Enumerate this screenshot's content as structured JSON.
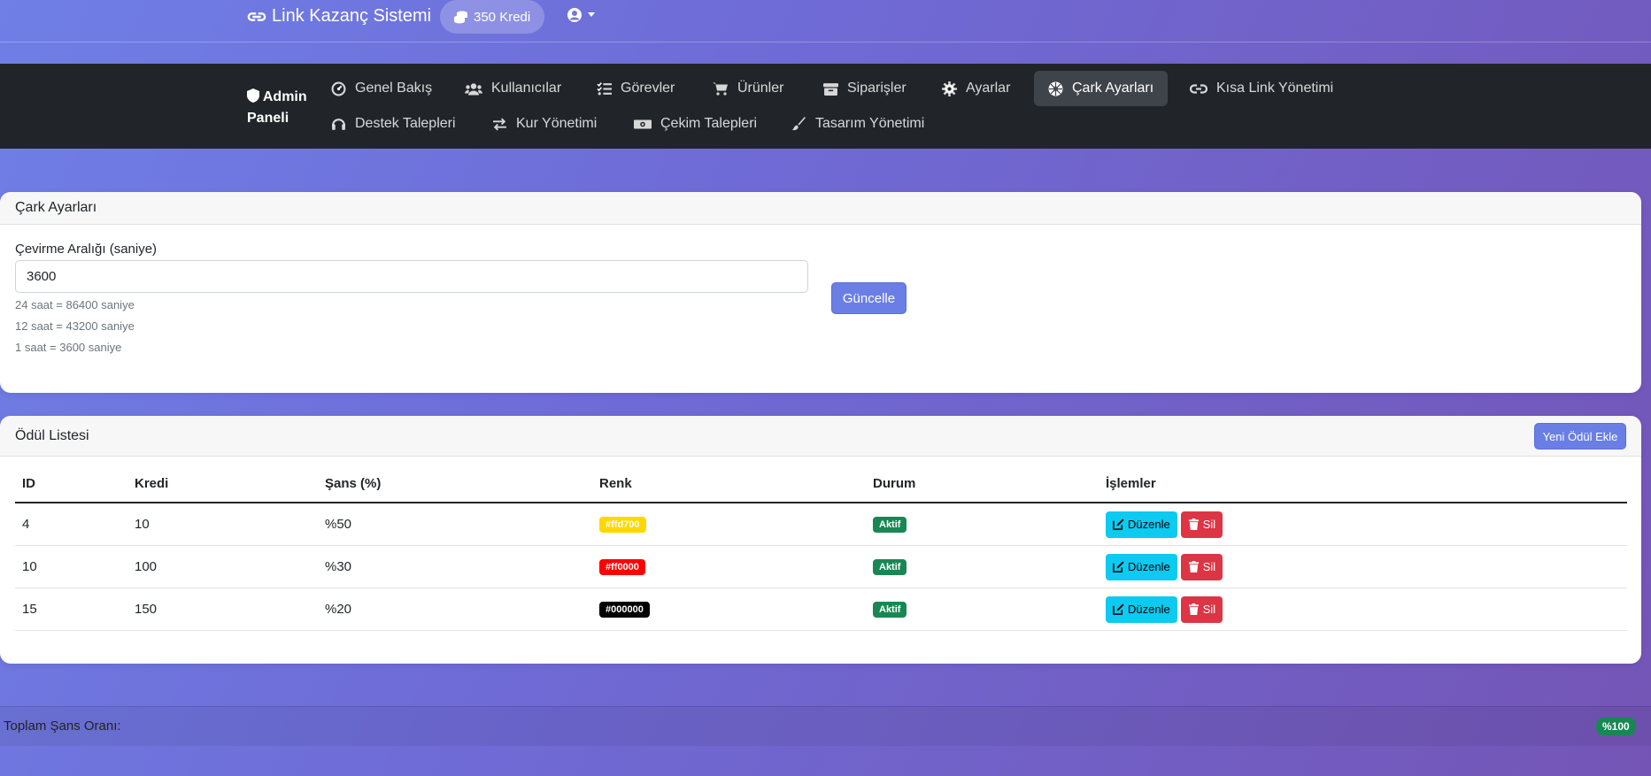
{
  "navbar": {
    "brand": "Link Kazanç Sistemi",
    "credits": "350 Kredi"
  },
  "admin_nav": {
    "title_line1": "Admin",
    "title_line2": "Paneli",
    "items": [
      {
        "label": "Genel Bakış",
        "icon": "gauge-icon"
      },
      {
        "label": "Kullanıcılar",
        "icon": "users-icon"
      },
      {
        "label": "Görevler",
        "icon": "tasks-icon"
      },
      {
        "label": "Ürünler",
        "icon": "cart-icon"
      },
      {
        "label": "Siparişler",
        "icon": "box-icon"
      },
      {
        "label": "Ayarlar",
        "icon": "gear-icon"
      },
      {
        "label": "Çark Ayarları",
        "icon": "wheel-icon",
        "active": true
      },
      {
        "label": "Kısa Link Yönetimi",
        "icon": "link-icon"
      },
      {
        "label": "Destek Talepleri",
        "icon": "headset-icon"
      },
      {
        "label": "Kur Yönetimi",
        "icon": "exchange-icon"
      },
      {
        "label": "Çekim Talepleri",
        "icon": "money-icon"
      },
      {
        "label": "Tasarım Yönetimi",
        "icon": "brush-icon"
      }
    ]
  },
  "wheel_settings": {
    "header": "Çark Ayarları",
    "interval_label": "Çevirme Aralığı (saniye)",
    "interval_value": "3600",
    "hints": [
      "24 saat = 86400 saniye",
      "12 saat = 43200 saniye",
      "1 saat = 3600 saniye"
    ],
    "update_button": "Güncelle"
  },
  "rewards": {
    "header": "Ödül Listesi",
    "add_button": "Yeni Ödül Ekle",
    "columns": [
      "ID",
      "Kredi",
      "Şans (%)",
      "Renk",
      "Durum",
      "İşlemler"
    ],
    "rows": [
      {
        "id": "4",
        "kredi": "10",
        "sans": "%50",
        "renk": "#ffd700",
        "text_color": "#ffffff",
        "durum": "Aktif"
      },
      {
        "id": "10",
        "kredi": "100",
        "sans": "%30",
        "renk": "#ff0000",
        "text_color": "#ffffff",
        "durum": "Aktif"
      },
      {
        "id": "15",
        "kredi": "150",
        "sans": "%20",
        "renk": "#000000",
        "text_color": "#ffffff",
        "durum": "Aktif"
      }
    ],
    "edit_label": "Düzenle",
    "delete_label": "Sil"
  },
  "footer": {
    "label": "Toplam Şans Oranı:",
    "total": "%100"
  }
}
